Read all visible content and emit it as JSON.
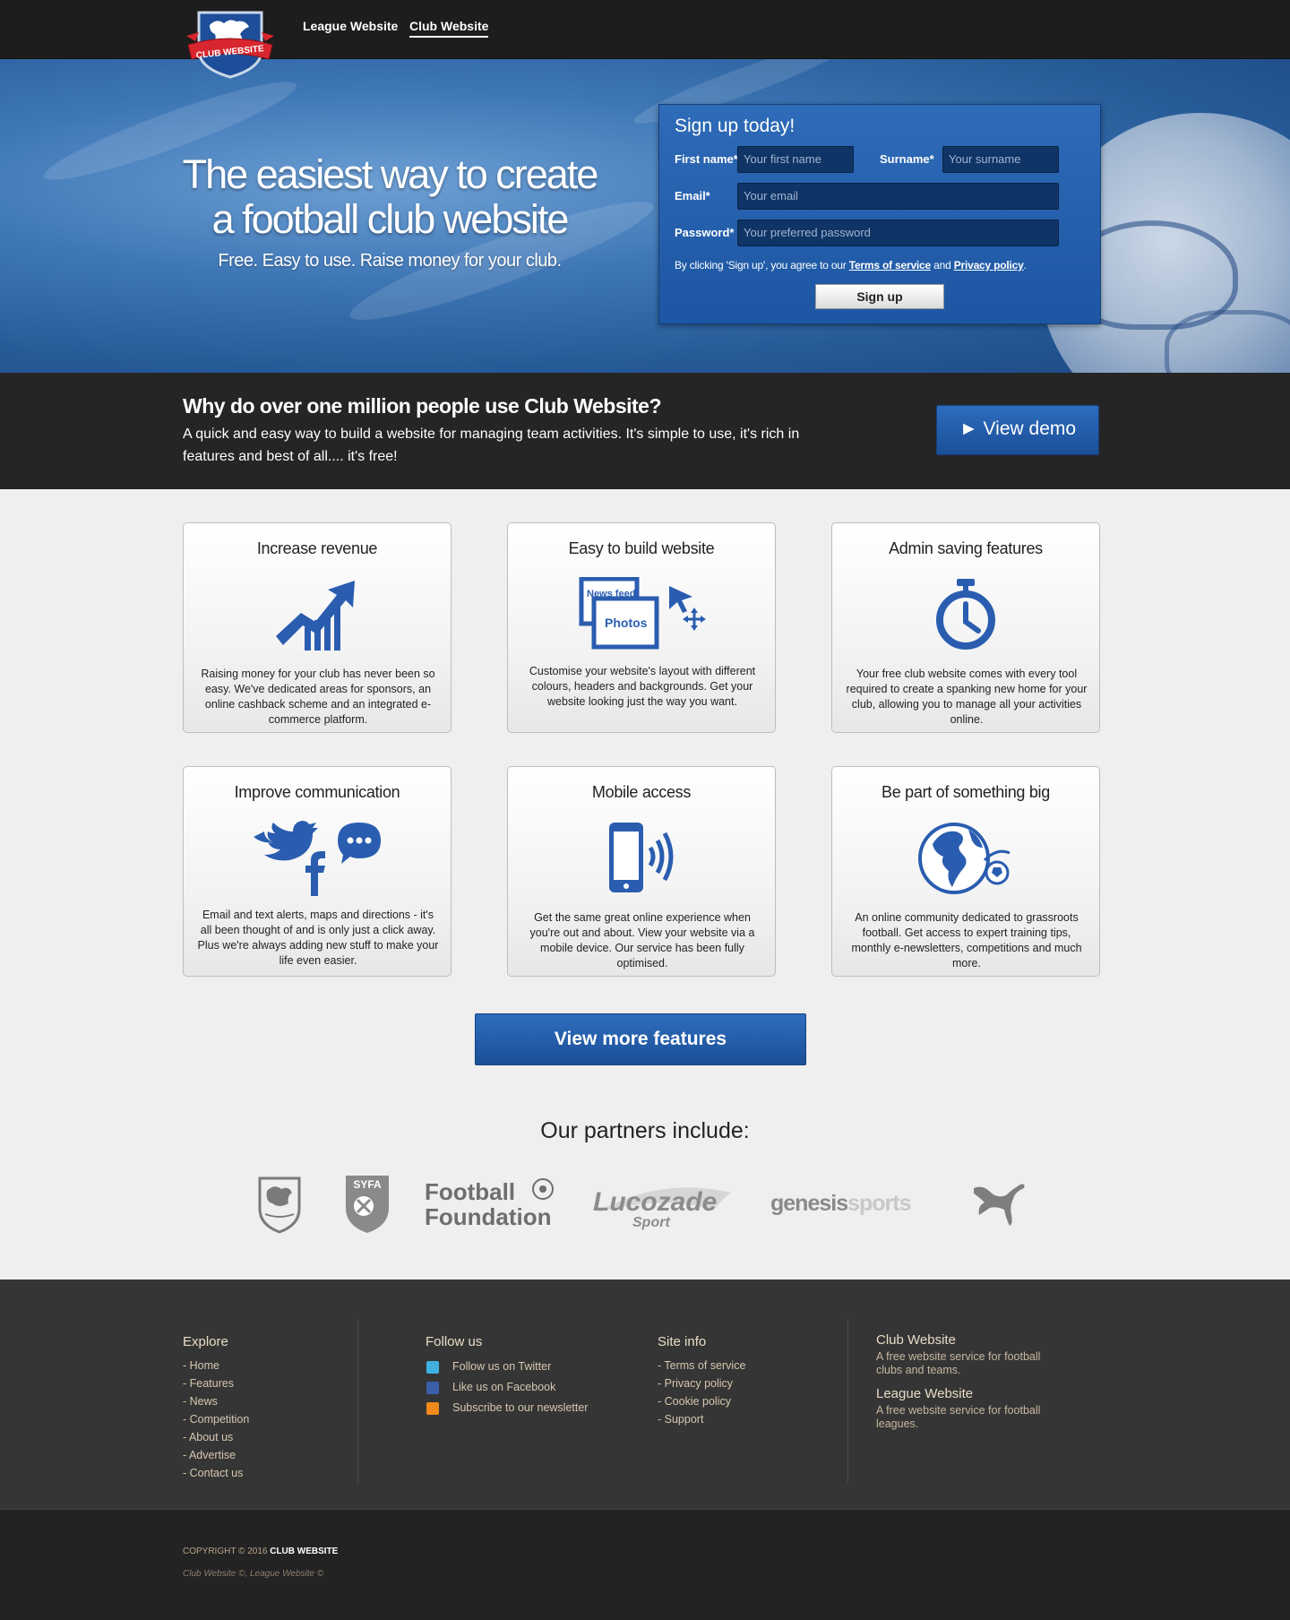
{
  "nav": {
    "logo_text": "CLUB WEBSITE",
    "links": [
      "League Website",
      "Club Website"
    ]
  },
  "hero": {
    "headline": "The easiest way to create a football club website",
    "subline": "Free. Easy to use. Raise money for your club."
  },
  "signup": {
    "title": "Sign up today!",
    "first_name_label": "First name*",
    "first_name_placeholder": "Your first name",
    "surname_label": "Surname*",
    "surname_placeholder": "Your surname",
    "email_label": "Email*",
    "email_placeholder": "Your email",
    "password_label": "Password*",
    "password_placeholder": "Your preferred password",
    "agree_prefix": "By clicking 'Sign up', you agree to our ",
    "terms_link": "Terms of service",
    "agree_and": " and ",
    "privacy_link": "Privacy policy",
    "agree_suffix": ".",
    "button": "Sign up"
  },
  "why": {
    "title": "Why do over one million people use Club Website?",
    "text": "A quick and easy way to build a website for managing team activities. It's simple to use, it's rich in features and best of all.... it's free!",
    "demo_button": "► View demo"
  },
  "features": [
    {
      "title": "Increase revenue",
      "icon": "chart-growth-icon",
      "text": "Raising money for your club has never been so easy. We've dedicated areas for sponsors, an online cashback scheme and an integrated e-commerce platform."
    },
    {
      "title": "Easy to build website",
      "icon": "layout-builder-icon",
      "text": "Customise your website's layout with different colours, headers and backgrounds. Get your website looking just the way you want.",
      "icon_labels": [
        "News feed",
        "Photos"
      ]
    },
    {
      "title": "Admin saving features",
      "icon": "stopwatch-icon",
      "text": "Your free club website comes with every tool required to create a spanking new home for your club, allowing you to manage all your activities online."
    },
    {
      "title": "Improve communication",
      "icon": "social-icons",
      "text": "Email and text alerts, maps and directions - it's all been thought of and is only just a click away. Plus we're always adding new stuff to make your life even easier."
    },
    {
      "title": "Mobile access",
      "icon": "mobile-phone-icon",
      "text": "Get the same great online experience when you're out and about. View your website via a mobile device. Our service has been fully optimised."
    },
    {
      "title": "Be part of something big",
      "icon": "globe-ball-icon",
      "text": "An online community dedicated to grassroots football. Get access to expert training tips, monthly e-newsletters, competitions and much more."
    }
  ],
  "more_button": "View more features",
  "partners": {
    "title": "Our partners include:",
    "logos": [
      "SYFA",
      "Football",
      "Foundation",
      "Lucozade",
      "Sport",
      "genesis",
      "sports"
    ]
  },
  "footer": {
    "explore_title": "Explore",
    "explore_links": [
      "- Home",
      "- Features",
      "- News",
      "- Competition",
      "- About us",
      "- Advertise",
      "- Contact us"
    ],
    "follow_title": "Follow us",
    "follow_links": [
      "Follow us on Twitter",
      "Like us on Facebook",
      "Subscribe to our newsletter"
    ],
    "siteinfo_title": "Site info",
    "siteinfo_links": [
      "- Terms of service",
      "- Privacy policy",
      "- Cookie policy",
      "- Support"
    ],
    "club_title": "Club Website",
    "club_text": "A free website service for football clubs and teams.",
    "league_title": "League Website",
    "league_text": "A free website service for football leagues.",
    "copyright_prefix": "COPYRIGHT © 2016 ",
    "copyright_brand": "CLUB WEBSITE",
    "trademark": "Club Website ©, League Website ©"
  },
  "colors": {
    "brand_blue": "#1d56a3",
    "dark_band": "#252525",
    "footer_bg": "#353535"
  }
}
